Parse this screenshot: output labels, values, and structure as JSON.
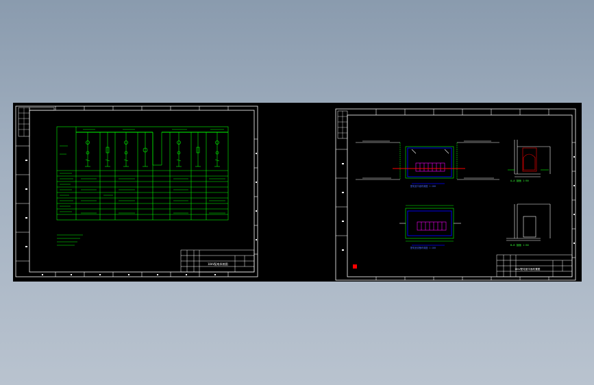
{
  "left_sheet": {
    "title_block_caption": "10kV配电系统图"
  },
  "right_sheet": {
    "title_block_caption": "10kV配电室平面布置图",
    "section_a_label": "A—A 剖面 1:50",
    "section_b_label": "B—B 剖面 1:50",
    "plan_label_1": "配电室平面布置图 1:100",
    "plan_label_2": "配电室设备布置图 1:100"
  },
  "colors": {
    "drawing_bg": "#000000",
    "line_white": "#ffffff",
    "line_green": "#00ff00",
    "line_blue": "#0000ff",
    "line_red": "#ff0000",
    "line_magenta": "#ff00ff"
  }
}
